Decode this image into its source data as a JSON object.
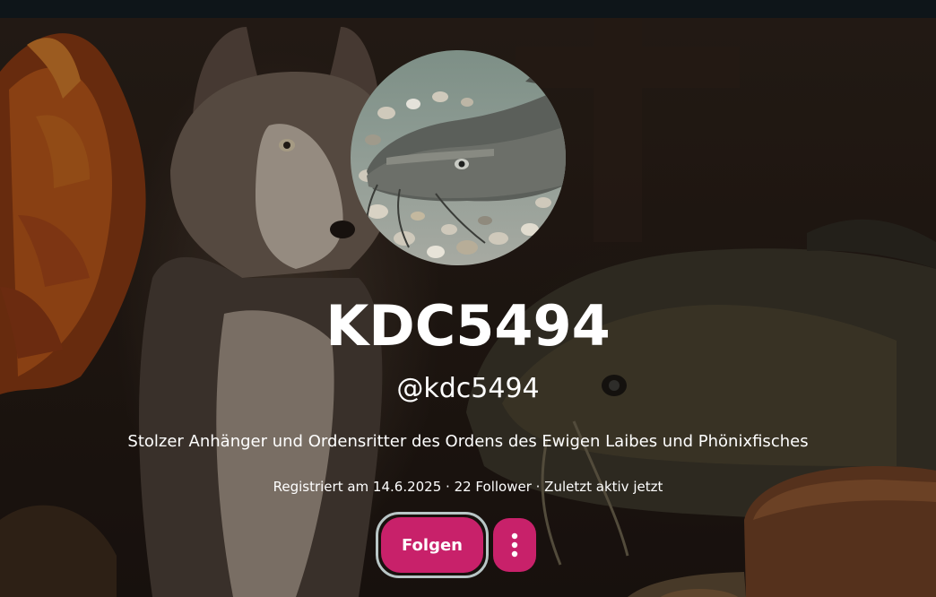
{
  "profile": {
    "display_name": "KDC5494",
    "handle": "@kdc5494",
    "bio": "Stolzer Anhänger und Ordensritter des Ordens des Ewigen Laibes und Phönixfisches",
    "meta": "Registriert am 14.6.2025 · 22 Follower · Zuletzt aktiv jetzt"
  },
  "actions": {
    "follow_label": "Folgen",
    "more_icon": "more-vertical-icon"
  },
  "colors": {
    "accent": "#c8216a",
    "focus_ring": "#b9c6c6",
    "top_bar": "#0e1519"
  }
}
